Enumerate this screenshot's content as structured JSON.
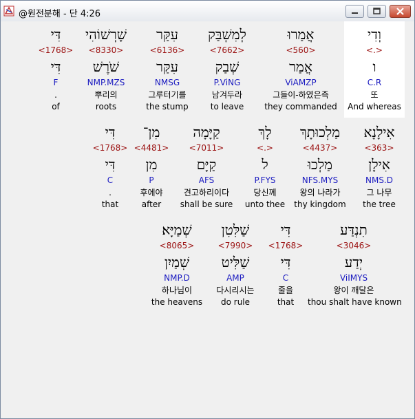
{
  "window": {
    "title": "@원전분해 - 단 4:26",
    "buttons": [
      "minimize",
      "maximize",
      "close"
    ]
  },
  "lines": [
    [
      {
        "heb": "וְדִי",
        "strong": "<.>",
        "lex": "ו",
        "parse": "C.R",
        "kor": "또",
        "eng": "And whereas",
        "highlight": true
      },
      {
        "heb": "אֲמַרוּ",
        "strong": "<560>",
        "lex": "אֲמַר",
        "parse": "ViAMZP",
        "kor": "그들이-하였은즉",
        "eng": "they commanded"
      },
      {
        "heb": "לְמִשְׁבַּק",
        "strong": "<7662>",
        "lex": "שְׁבַק",
        "parse": "P.ViNG",
        "kor": "남겨두라",
        "eng": "to leave"
      },
      {
        "heb": "עִקַּר",
        "strong": "<6136>",
        "lex": "עִקַּר",
        "parse": "NMSG",
        "kor": "그루터기를",
        "eng": "the stump"
      },
      {
        "heb": "שָׁרְשׁוֹהִי",
        "strong": "<8330>",
        "lex": "שֹׁרֶשׁ",
        "parse": "NMP.MZS",
        "kor": "뿌리의",
        "eng": "roots"
      },
      {
        "heb": "דִּי",
        "strong": "<1768>",
        "lex": "דִּי",
        "parse": "F",
        "kor": ".",
        "eng": "of"
      }
    ],
    [
      {
        "heb": "אִילָנָא",
        "strong": "<363>",
        "lex": "אִילָן",
        "parse": "NMS.D",
        "kor": "그 나무",
        "eng": "the tree"
      },
      {
        "heb": "מַלְכוּתָךְ",
        "strong": "<4437>",
        "lex": "מַלְכוּ",
        "parse": "NFS.MYS",
        "kor": "왕의 나라가",
        "eng": "thy kingdom"
      },
      {
        "heb": "לָךְ",
        "strong": "<.>",
        "lex": "ל",
        "parse": "P.FYS",
        "kor": "당신께",
        "eng": "unto thee"
      },
      {
        "heb": "קַיָּמָה",
        "strong": "<7011>",
        "lex": "קַיָּם",
        "parse": "AFS",
        "kor": "견고하리이다",
        "eng": "shall be sure"
      },
      {
        "heb": "מִן־",
        "strong": "<4481>",
        "lex": "מִן",
        "parse": "P",
        "kor": "후에야",
        "eng": "after"
      },
      {
        "heb": "דִּי",
        "strong": "<1768>",
        "lex": "דִּי",
        "parse": "C",
        "kor": ".",
        "eng": "that"
      }
    ],
    [
      {
        "heb": "תִנְדַּע",
        "strong": "<3046>",
        "lex": "יְדַע",
        "parse": "ViIMYS",
        "kor": "왕이 깨달은",
        "eng": "thou shalt have known"
      },
      {
        "heb": "דִּי",
        "strong": "<1768>",
        "lex": "דִּי",
        "parse": "C",
        "kor": "줄을",
        "eng": "that"
      },
      {
        "heb": "שַׁלִּטִן",
        "strong": "<7990>",
        "lex": "שַׁלִּיט",
        "parse": "AMP",
        "kor": "다시리시는",
        "eng": "do rule"
      },
      {
        "heb": "שְׁמַיָּא׃",
        "strong": "<8065>",
        "lex": "שְׁמַיִן",
        "parse": "NMP.D",
        "kor": "하나님이",
        "eng": "the heavens"
      }
    ]
  ]
}
